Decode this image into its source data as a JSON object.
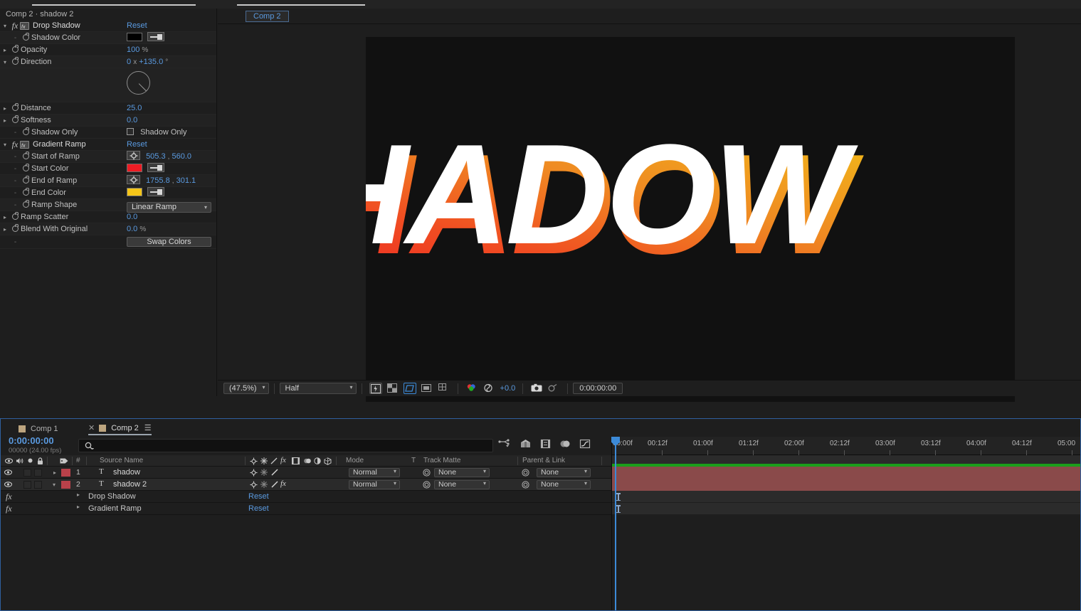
{
  "effect_controls": {
    "panel_title": "Comp 2 · shadow 2",
    "effects": [
      {
        "name": "Drop Shadow",
        "reset_label": "Reset",
        "properties": [
          {
            "label": "Shadow Color",
            "type": "color",
            "value": "#000000"
          },
          {
            "label": "Opacity",
            "type": "number",
            "value": "100",
            "unit": "%"
          },
          {
            "label": "Direction",
            "type": "angle",
            "value": "0",
            "unit_x": "x",
            "value2": "+135.0",
            "unit_deg": "°"
          },
          {
            "label": "Distance",
            "type": "number",
            "value": "25.0"
          },
          {
            "label": "Softness",
            "type": "number",
            "value": "0.0"
          },
          {
            "label": "Shadow Only",
            "type": "checkbox",
            "checkbox_label": "Shadow Only",
            "checked": false
          }
        ]
      },
      {
        "name": "Gradient Ramp",
        "reset_label": "Reset",
        "properties": [
          {
            "label": "Start of Ramp",
            "type": "point",
            "value": "505.3",
            "value2": "560.0"
          },
          {
            "label": "Start Color",
            "type": "color",
            "value": "#ED1C24"
          },
          {
            "label": "End of Ramp",
            "type": "point",
            "value": "1755.8",
            "value2": "301.1"
          },
          {
            "label": "End Color",
            "type": "color",
            "value": "#F5C518"
          },
          {
            "label": "Ramp Shape",
            "type": "dropdown",
            "value": "Linear Ramp"
          },
          {
            "label": "Ramp Scatter",
            "type": "number",
            "value": "0.0"
          },
          {
            "label": "Blend With Original",
            "type": "number",
            "value": "0.0",
            "unit": "%"
          }
        ],
        "swap_button": "Swap Colors"
      }
    ]
  },
  "viewer": {
    "tab_label": "Comp 2",
    "comp_text": "SHADOW",
    "toolbar": {
      "zoom_level": "(47.5%)",
      "resolution": "Half",
      "exposure": "+0.0",
      "timecode": "0:00:00:00"
    }
  },
  "timeline": {
    "tabs": [
      {
        "label": "Comp 1",
        "active": false
      },
      {
        "label": "Comp 2",
        "active": true
      }
    ],
    "current_time": "0:00:00:00",
    "frame_info": "00000 (24.00 fps)",
    "search_placeholder": "",
    "columns": [
      {
        "label": "#"
      },
      {
        "label": "Source Name"
      },
      {
        "label": "Mode"
      },
      {
        "label": "T"
      },
      {
        "label": "Track Matte"
      },
      {
        "label": "Parent & Link"
      }
    ],
    "layers": [
      {
        "index": "1",
        "type_icon": "T",
        "name": "shadow",
        "mode": "Normal",
        "track_matte": "None",
        "parent": "None",
        "expanded": false
      },
      {
        "index": "2",
        "type_icon": "T",
        "name": "shadow 2",
        "mode": "Normal",
        "track_matte": "None",
        "parent": "None",
        "expanded": true
      }
    ],
    "effect_rows": [
      {
        "name": "Drop Shadow",
        "reset_label": "Reset"
      },
      {
        "name": "Gradient Ramp",
        "reset_label": "Reset"
      }
    ],
    "ruler_ticks": [
      "00:00f",
      "00:12f",
      "01:00f",
      "01:12f",
      "02:00f",
      "02:12f",
      "03:00f",
      "03:12f",
      "04:00f",
      "04:12f",
      "05:00"
    ]
  },
  "colors": {
    "accent_blue": "#5a9ae0",
    "layer_bar": "#8a4a4a",
    "render_bar": "#1b9e1b",
    "label_color": "#b9414a"
  }
}
